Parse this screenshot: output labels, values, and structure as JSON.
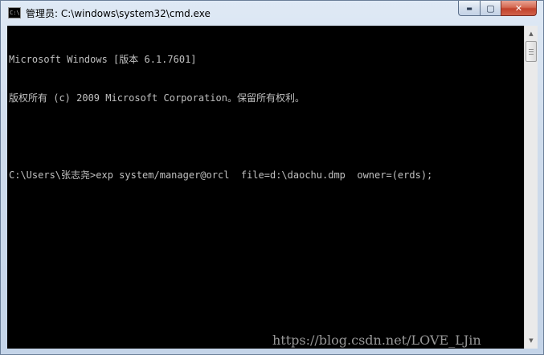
{
  "window": {
    "title": "管理员: C:\\windows\\system32\\cmd.exe",
    "icon": "cmd-icon",
    "icon_label": "C:\\",
    "controls": {
      "minimize": "▬",
      "maximize": "▢",
      "close": "✕"
    }
  },
  "console": {
    "line1": "Microsoft Windows [版本 6.1.7601]",
    "line2": "版权所有 (c) 2009 Microsoft Corporation。保留所有权利。",
    "line3": "",
    "line4": "C:\\Users\\张志尧>exp system/manager@orcl  file=d:\\daochu.dmp  owner=(erds);",
    "foreground": "#c0c0c0",
    "background": "#000000"
  },
  "scrollbar": {
    "up_arrow": "▲",
    "down_arrow": "▼"
  },
  "watermark": "https://blog.csdn.net/LOVE_LJin"
}
